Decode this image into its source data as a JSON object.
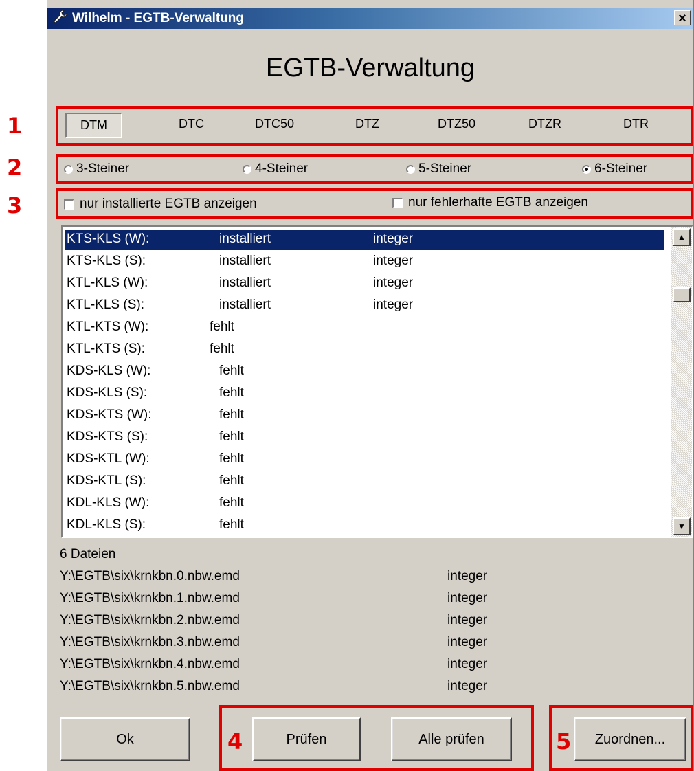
{
  "window": {
    "title": "Wilhelm - EGTB-Verwaltung",
    "close": "×"
  },
  "heading": "EGTB-Verwaltung",
  "markers": [
    "1",
    "2",
    "3",
    "4",
    "5"
  ],
  "tabs": [
    "DTM",
    "DTC",
    "DTC50",
    "DTZ",
    "DTZ50",
    "DTZR",
    "DTR"
  ],
  "active_tab": "DTM",
  "radios": [
    {
      "label": "3-Steiner",
      "checked": false
    },
    {
      "label": "4-Steiner",
      "checked": false
    },
    {
      "label": "5-Steiner",
      "checked": false
    },
    {
      "label": "6-Steiner",
      "checked": true
    }
  ],
  "checkboxes": [
    {
      "label": "nur installierte EGTB anzeigen",
      "checked": false
    },
    {
      "label": "nur fehlerhafte EGTB anzeigen",
      "checked": false
    }
  ],
  "list": {
    "rows": [
      {
        "name": "KTS-KLS (W):",
        "status": "installiert",
        "type": "integer",
        "selected": true
      },
      {
        "name": "KTS-KLS (S):",
        "status": "installiert",
        "type": "integer"
      },
      {
        "name": "KTL-KLS (W):",
        "status": "installiert",
        "type": "integer"
      },
      {
        "name": "KTL-KLS (S):",
        "status": "installiert",
        "type": "integer"
      },
      {
        "name": "KTL-KTS (W):",
        "status": "fehlt",
        "type": ""
      },
      {
        "name": "KTL-KTS (S):",
        "status": "fehlt",
        "type": ""
      },
      {
        "name": "KDS-KLS (W):",
        "status": "fehlt",
        "type": ""
      },
      {
        "name": "KDS-KLS (S):",
        "status": "fehlt",
        "type": ""
      },
      {
        "name": "KDS-KTS (W):",
        "status": "fehlt",
        "type": ""
      },
      {
        "name": "KDS-KTS (S):",
        "status": "fehlt",
        "type": ""
      },
      {
        "name": "KDS-KTL (W):",
        "status": "fehlt",
        "type": ""
      },
      {
        "name": "KDS-KTL (S):",
        "status": "fehlt",
        "type": ""
      },
      {
        "name": "KDL-KLS (W):",
        "status": "fehlt",
        "type": ""
      },
      {
        "name": "KDL-KLS (S):",
        "status": "fehlt",
        "type": ""
      }
    ]
  },
  "files": {
    "count_label": "6 Dateien",
    "items": [
      {
        "path": "Y:\\EGTB\\six\\krnkbn.0.nbw.emd",
        "type": "integer"
      },
      {
        "path": "Y:\\EGTB\\six\\krnkbn.1.nbw.emd",
        "type": "integer"
      },
      {
        "path": "Y:\\EGTB\\six\\krnkbn.2.nbw.emd",
        "type": "integer"
      },
      {
        "path": "Y:\\EGTB\\six\\krnkbn.3.nbw.emd",
        "type": "integer"
      },
      {
        "path": "Y:\\EGTB\\six\\krnkbn.4.nbw.emd",
        "type": "integer"
      },
      {
        "path": "Y:\\EGTB\\six\\krnkbn.5.nbw.emd",
        "type": "integer"
      }
    ]
  },
  "buttons": {
    "ok": "Ok",
    "check": "Prüfen",
    "check_all": "Alle prüfen",
    "assign": "Zuordnen..."
  },
  "colors": {
    "annotation": "#e00000",
    "selection": "#0a246a",
    "dialog": "#d4d0c8"
  }
}
